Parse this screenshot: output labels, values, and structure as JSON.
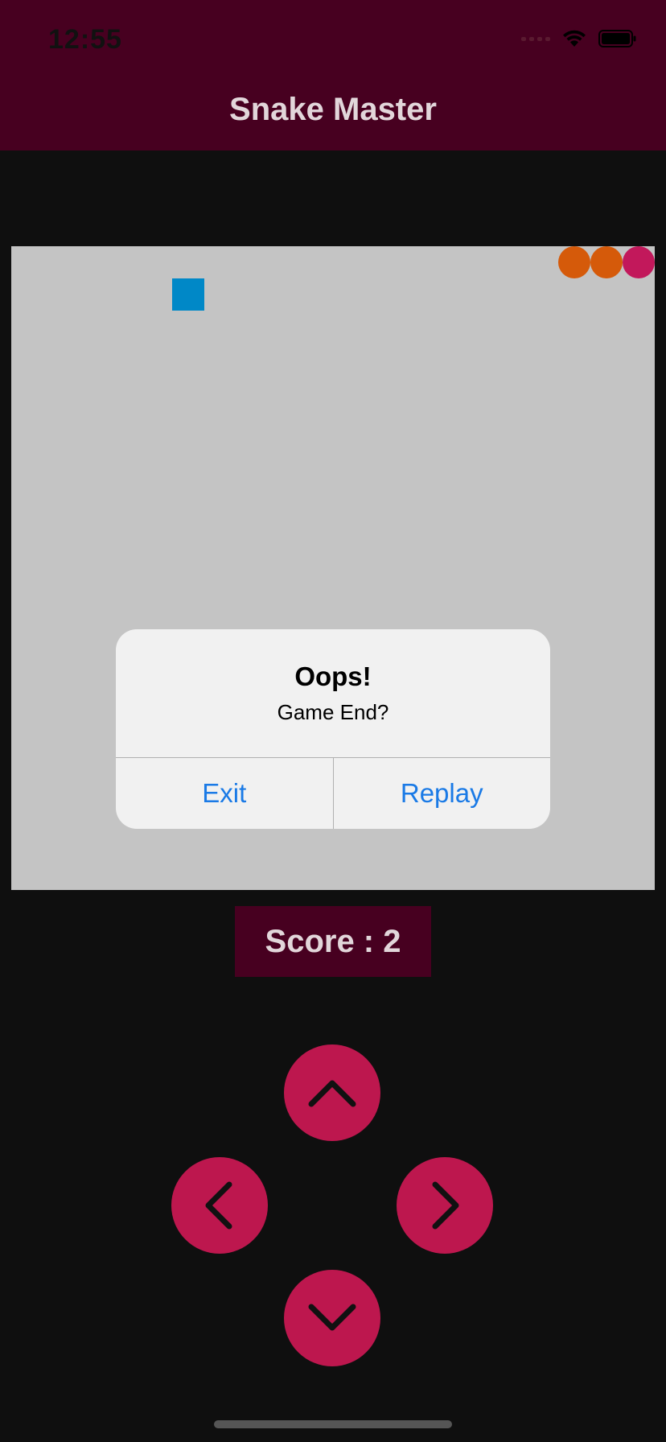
{
  "status_bar": {
    "time": "12:55",
    "icons": [
      "signal-icon",
      "wifi-icon",
      "battery-icon"
    ]
  },
  "header": {
    "title": "Snake Master",
    "background": "#470020"
  },
  "board": {
    "background": "#c4c4c4",
    "food_color": "#0088c7",
    "snake_colors": [
      "#d55a0a",
      "#d55a0a",
      "#c2185b"
    ]
  },
  "dialog": {
    "title": "Oops!",
    "message": "Game End?",
    "buttons": {
      "exit": "Exit",
      "replay": "Replay"
    },
    "button_color": "#1a7ae6"
  },
  "score": {
    "text": "Score : 2"
  },
  "controls": {
    "color": "#bd174e",
    "icons": [
      "chevron-up-icon",
      "chevron-left-icon",
      "chevron-right-icon",
      "chevron-down-icon"
    ]
  }
}
